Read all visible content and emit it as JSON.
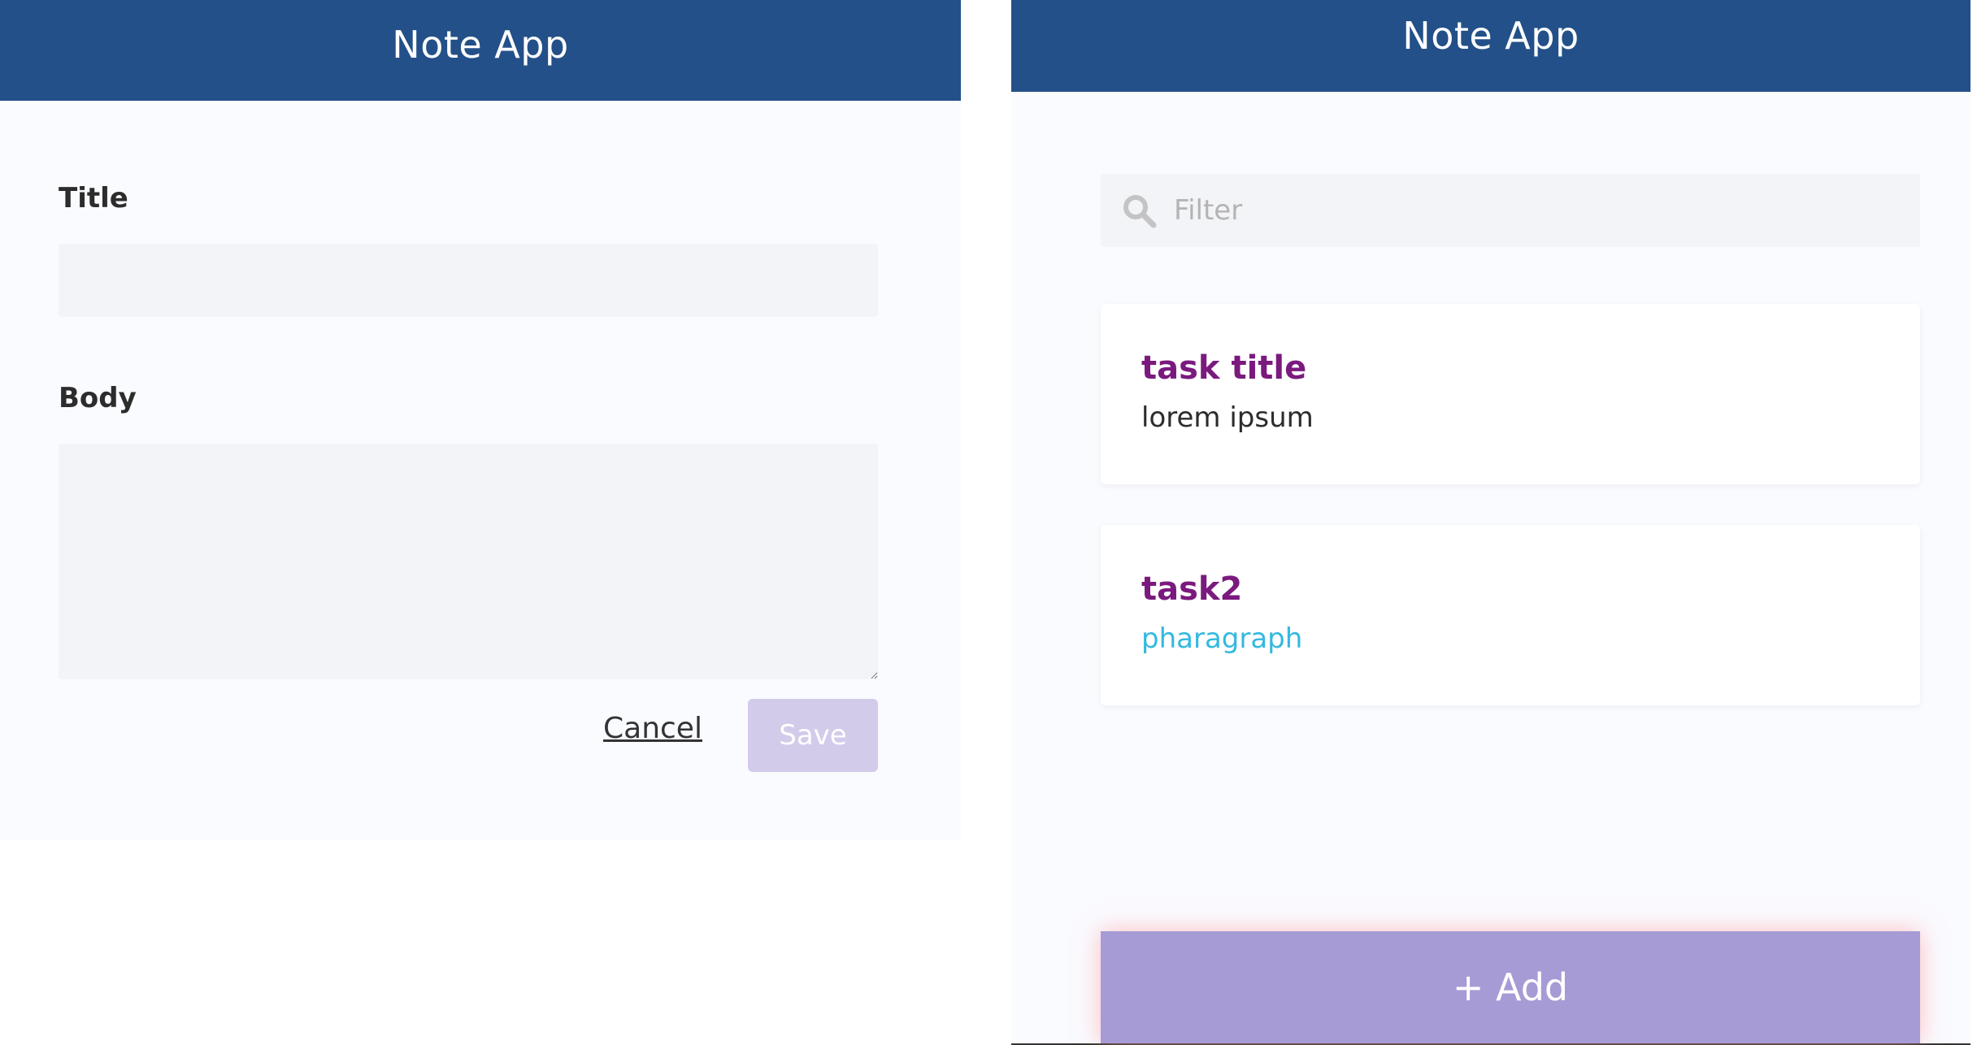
{
  "editor": {
    "app_title": "Note App",
    "title_label": "Title",
    "title_value": "",
    "body_label": "Body",
    "body_value": "",
    "cancel_label": "Cancel",
    "save_label": "Save"
  },
  "list": {
    "app_title": "Note App",
    "filter_placeholder": "Filter",
    "filter_icon": "search-icon",
    "notes": [
      {
        "title": "task title",
        "body": "lorem ipsum",
        "body_color": "#2c2c2c"
      },
      {
        "title": "task2",
        "body": "pharagraph",
        "body_color": "#33b9df"
      }
    ],
    "add_label": "+ Add"
  },
  "colors": {
    "header": "#235088",
    "note_title": "#7b1a7e",
    "save_disabled": "#d2cbea",
    "add_button": "#a79bd5"
  }
}
